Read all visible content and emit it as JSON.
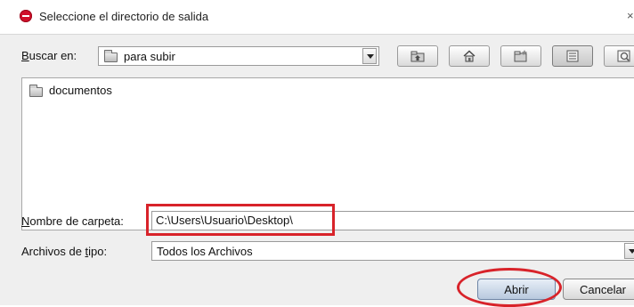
{
  "window": {
    "title": "Seleccione el directorio de salida",
    "close_glyph": "×",
    "app_icon": "app-logo-icon"
  },
  "toolbar": {
    "look_in_label": "Buscar en:",
    "look_in_mnemonic": "B",
    "look_in_rest": "uscar en:",
    "look_in_value": "para subir",
    "buttons": [
      {
        "name": "up-folder-icon"
      },
      {
        "name": "home-icon"
      },
      {
        "name": "new-folder-icon"
      },
      {
        "name": "list-view-icon"
      },
      {
        "name": "details-view-icon"
      }
    ]
  },
  "file_list": {
    "items": [
      {
        "name": "documentos",
        "icon": "folder-icon"
      }
    ]
  },
  "folder_name": {
    "label_mnemonic": "N",
    "label_rest": "ombre de carpeta:",
    "value": "C:\\Users\\Usuario\\Desktop\\"
  },
  "file_type": {
    "label_before": "Archivos de ",
    "label_mnemonic": "t",
    "label_after": "ipo:",
    "value": "Todos los Archivos"
  },
  "actions": {
    "open_label": "Abrir",
    "cancel_label": "Cancelar"
  },
  "colors": {
    "highlight": "#d8232a",
    "app_icon": "#d0102a",
    "dialog_bg": "#efefef"
  }
}
